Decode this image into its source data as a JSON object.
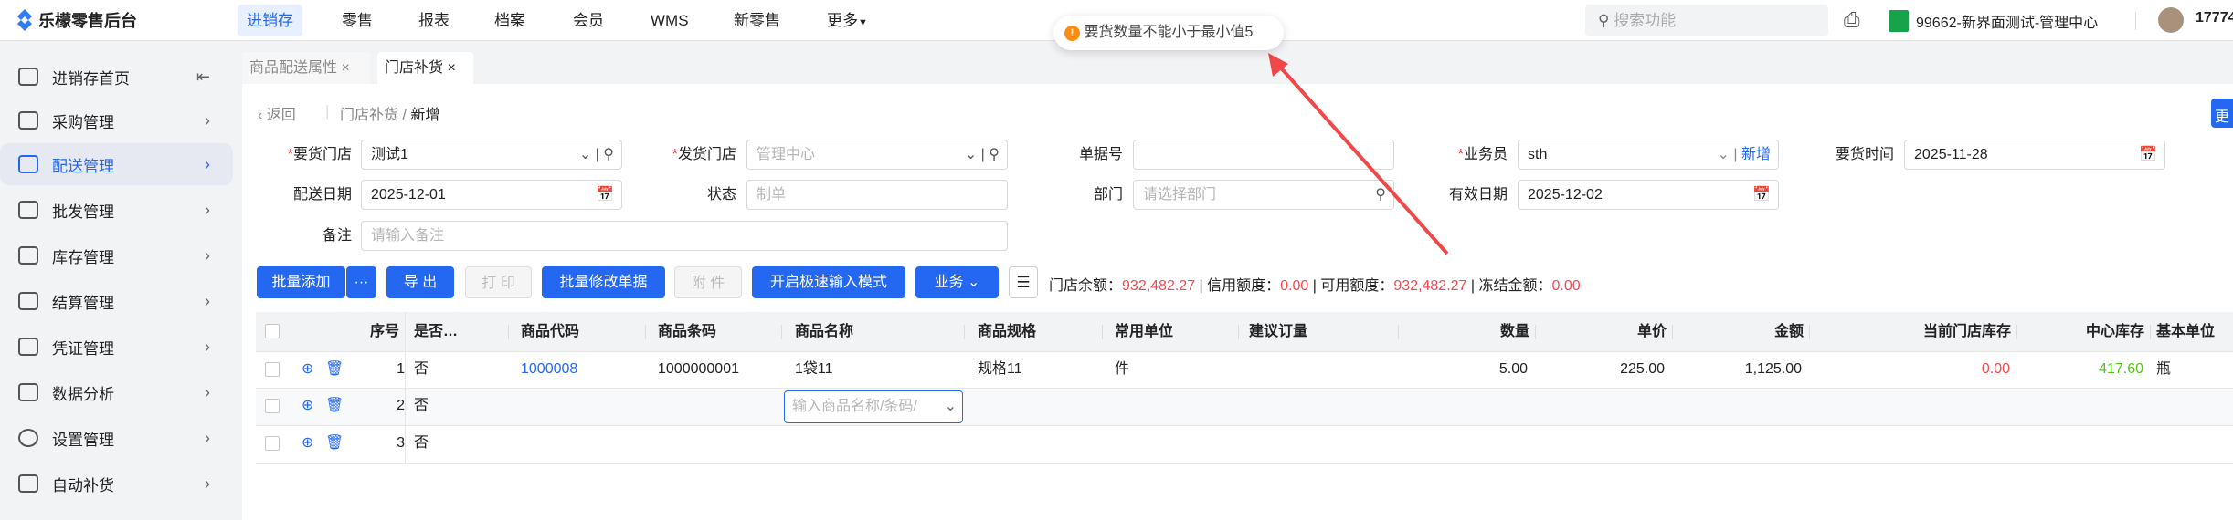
{
  "app": {
    "title": "乐檬零售后台"
  },
  "nav": [
    "进销存",
    "零售",
    "报表",
    "档案",
    "会员",
    "WMS",
    "新零售",
    "更多"
  ],
  "search": {
    "placeholder": "搜索功能"
  },
  "store": "99662-新界面测试-管理中心",
  "user": "17774",
  "toast": {
    "message": "要货数量不能小于最小值5",
    "icon": "warning-icon",
    "color": "#fa8c16"
  },
  "sidebar": [
    {
      "label": "进销存首页",
      "icon": "home-icon"
    },
    {
      "label": "采购管理",
      "icon": "cart-icon"
    },
    {
      "label": "配送管理",
      "icon": "map-icon",
      "active": true
    },
    {
      "label": "批发管理",
      "icon": "server-icon"
    },
    {
      "label": "库存管理",
      "icon": "inbox-icon"
    },
    {
      "label": "结算管理",
      "icon": "dollar-icon"
    },
    {
      "label": "凭证管理",
      "icon": "document-icon"
    },
    {
      "label": "数据分析",
      "icon": "chart-icon"
    },
    {
      "label": "设置管理",
      "icon": "settings-icon"
    },
    {
      "label": "自动补货",
      "icon": "basket-icon"
    }
  ],
  "tabs": [
    {
      "label": "商品配送属性"
    },
    {
      "label": "门店补货",
      "active": true
    }
  ],
  "breadcrumb": {
    "back": "返回",
    "parent": "门店补货",
    "current": "新增"
  },
  "right_button": "更",
  "form": {
    "req_store": {
      "label": "要货门店",
      "value": "测试1"
    },
    "ship_store": {
      "label": "发货门店",
      "placeholder": "管理中心"
    },
    "doc_no": {
      "label": "单据号",
      "value": ""
    },
    "salesman": {
      "label": "业务员",
      "value": "sth",
      "add": "新增"
    },
    "req_time": {
      "label": "要货时间",
      "value": "2025-11-28"
    },
    "ship_date": {
      "label": "配送日期",
      "value": "2025-12-01"
    },
    "status": {
      "label": "状态",
      "placeholder": "制单"
    },
    "dept": {
      "label": "部门",
      "placeholder": "请选择部门"
    },
    "valid_date": {
      "label": "有效日期",
      "value": "2025-12-02"
    },
    "remark": {
      "label": "备注",
      "placeholder": "请输入备注"
    }
  },
  "toolbar": {
    "batch_add": "批量添加",
    "more": "···",
    "export": "导 出",
    "print": "打 印",
    "batch_edit": "批量修改单据",
    "attach": "附 件",
    "fast_mode": "开启极速输入模式",
    "business": "业务"
  },
  "balance": {
    "store_label": "门店余额：",
    "store": "932,482.27",
    "credit_label": "信用额度：",
    "credit": "0.00",
    "avail_label": "可用额度：",
    "avail": "932,482.27",
    "frozen_label": "冻结金额：",
    "frozen": "0.00"
  },
  "table": {
    "headers": [
      "序号",
      "是否…",
      "商品代码",
      "商品条码",
      "商品名称",
      "商品规格",
      "常用单位",
      "建议订量",
      "数量",
      "单价",
      "金额",
      "当前门店库存",
      "中心库存",
      "基本单位"
    ],
    "rows": [
      {
        "no": "1",
        "flag": "否",
        "code": "1000008",
        "barcode": "1000000001",
        "name": "1袋11",
        "spec": "规格11",
        "unit": "件",
        "qty": "5.00",
        "price": "225.00",
        "amount": "1,125.00",
        "store_stock": "0.00",
        "center_stock": "417.60",
        "base_unit": "瓶"
      },
      {
        "no": "2",
        "flag": "否",
        "name_placeholder": "输入商品名称/条码/"
      },
      {
        "no": "3",
        "flag": "否"
      }
    ]
  }
}
